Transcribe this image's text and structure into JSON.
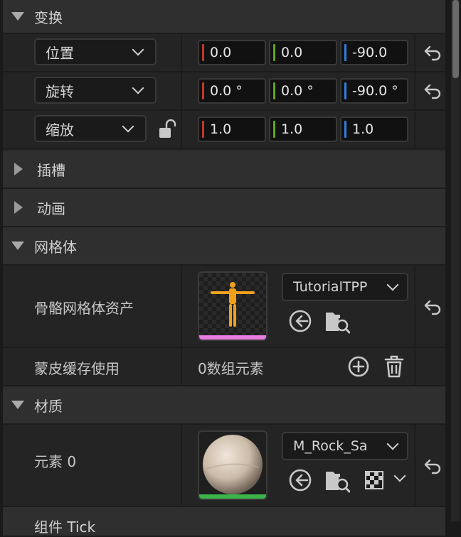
{
  "transform": {
    "section_title": "变换",
    "location": {
      "label": "位置",
      "x": "0.0",
      "y": "0.0",
      "z": "-90.0"
    },
    "rotation": {
      "label": "旋转",
      "x": "0.0 °",
      "y": "0.0 °",
      "z": "-90.0 °"
    },
    "scale": {
      "label": "缩放",
      "x": "1.0",
      "y": "1.0",
      "z": "1.0"
    }
  },
  "sockets": {
    "section_title": "插槽"
  },
  "animation": {
    "section_title": "动画"
  },
  "mesh": {
    "section_title": "网格体",
    "skeletal_mesh_asset": {
      "label": "骨骼网格体资产",
      "value": "TutorialTPP"
    },
    "skin_cache": {
      "label": "蒙皮缓存使用",
      "value": "0数组元素"
    }
  },
  "materials": {
    "section_title": "材质",
    "element0": {
      "label": "元素 0",
      "value": "M_Rock_Sa"
    }
  },
  "next_section_partial": "组件 Tick",
  "colors": {
    "axis_x": "#c0392b",
    "axis_y": "#5fa816",
    "axis_z": "#2f7ee0",
    "thumb_underline_mesh": "#e87ce0",
    "thumb_underline_material": "#3cb54a"
  },
  "icons": [
    "chevron-down-icon",
    "reset-arrow-icon",
    "lock-icon",
    "browse-arrow-icon",
    "find-in-browser-icon",
    "add-circle-icon",
    "trash-icon",
    "checker-icon"
  ]
}
